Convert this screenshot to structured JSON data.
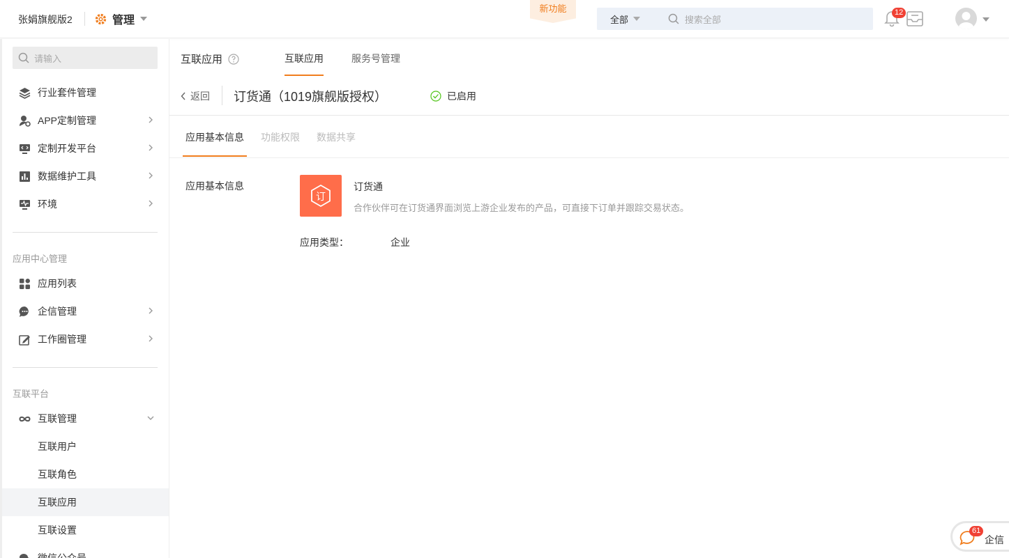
{
  "header": {
    "company": "张娟旗舰版2",
    "module": "管理",
    "new_feature": "新功能",
    "search_scope": "全部",
    "search_placeholder": "搜索全部",
    "notification_count": "12"
  },
  "sidebar": {
    "search_placeholder": "请输入",
    "items": [
      {
        "label": "行业套件管理",
        "icon": "layers-icon"
      },
      {
        "label": "APP定制管理",
        "icon": "app-custom-icon"
      },
      {
        "label": "定制开发平台",
        "icon": "dev-monitor-icon"
      },
      {
        "label": "数据维护工具",
        "icon": "bar-chart-icon"
      },
      {
        "label": "环境",
        "icon": "pulse-monitor-icon"
      }
    ],
    "group_app_center": "应用中心管理",
    "app_items": [
      {
        "label": "应用列表",
        "icon": "grid-icon"
      },
      {
        "label": "企信管理",
        "icon": "chat-bubble-icon"
      },
      {
        "label": "工作圈管理",
        "icon": "edit-icon"
      }
    ],
    "group_interconnect": "互联平台",
    "interconnect_parent": "互联管理",
    "interconnect_children": [
      "互联用户",
      "互联角色",
      "互联应用",
      "互联设置"
    ],
    "wechat_item": "微信公众号"
  },
  "main": {
    "page_title": "互联应用",
    "top_tabs": [
      "互联应用",
      "服务号管理"
    ],
    "back_label": "返回",
    "app_title": "订货通（1019旗舰版授权）",
    "status": "已启用",
    "sub_tabs": [
      "应用基本信息",
      "功能权限",
      "数据共享"
    ],
    "section_label": "应用基本信息",
    "app_name": "订货通",
    "app_description": "合作伙伴可在订货通界面浏览上游企业发布的产品，可直接下订单并跟踪交易状态。",
    "type_label": "应用类型：",
    "type_value": "企业",
    "logo_text": "订"
  },
  "chat": {
    "count": "61",
    "label": "企信"
  },
  "colors": {
    "accent": "#f07d1d",
    "logo_bg": "#ff6d4a",
    "badge": "#f04134",
    "status_green": "#52c41a"
  }
}
